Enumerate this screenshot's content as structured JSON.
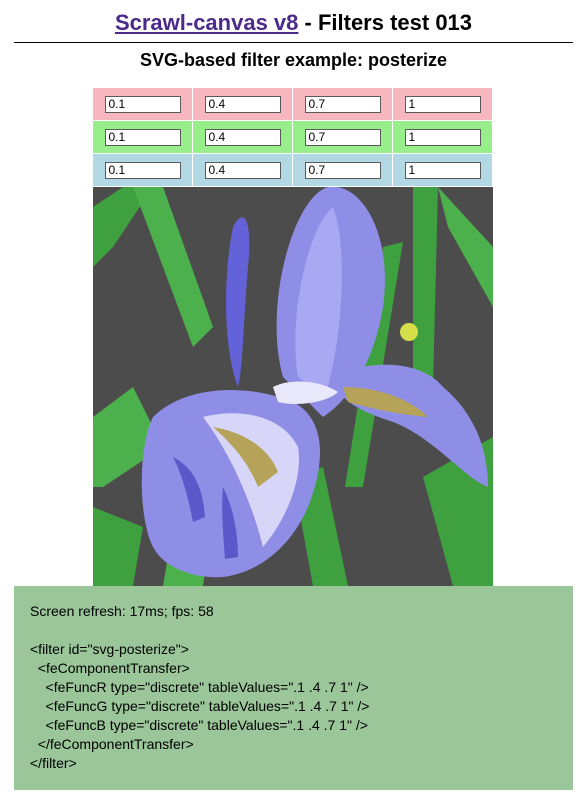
{
  "header": {
    "link_text": "Scrawl-canvas v8",
    "title_rest": " - Filters test 013",
    "subtitle": "SVG-based filter example: posterize"
  },
  "controls": {
    "rows": [
      {
        "channel": "red",
        "values": [
          "0.1",
          "0.4",
          "0.7",
          "1"
        ]
      },
      {
        "channel": "green",
        "values": [
          "0.1",
          "0.4",
          "0.7",
          "1"
        ]
      },
      {
        "channel": "blue",
        "values": [
          "0.1",
          "0.4",
          "0.7",
          "1"
        ]
      }
    ]
  },
  "colors": {
    "red_row": "#f6b7bf",
    "green_row": "#97ee8a",
    "blue_row": "#b1d8e3",
    "report_bg": "#9ac69a",
    "link": "#4b2a8a",
    "canvas_bg": "#4c4c4c"
  },
  "canvas": {
    "image_subject": "posterized iris flower"
  },
  "report": {
    "refresh_line": "Screen refresh: 17ms; fps: 58",
    "code_lines": [
      "<filter id=\"svg-posterize\">",
      "  <feComponentTransfer>",
      "    <feFuncR type=\"discrete\" tableValues=\".1 .4 .7 1\" />",
      "    <feFuncG type=\"discrete\" tableValues=\".1 .4 .7 1\" />",
      "    <feFuncB type=\"discrete\" tableValues=\".1 .4 .7 1\" />",
      "  </feComponentTransfer>",
      "</filter>"
    ]
  }
}
